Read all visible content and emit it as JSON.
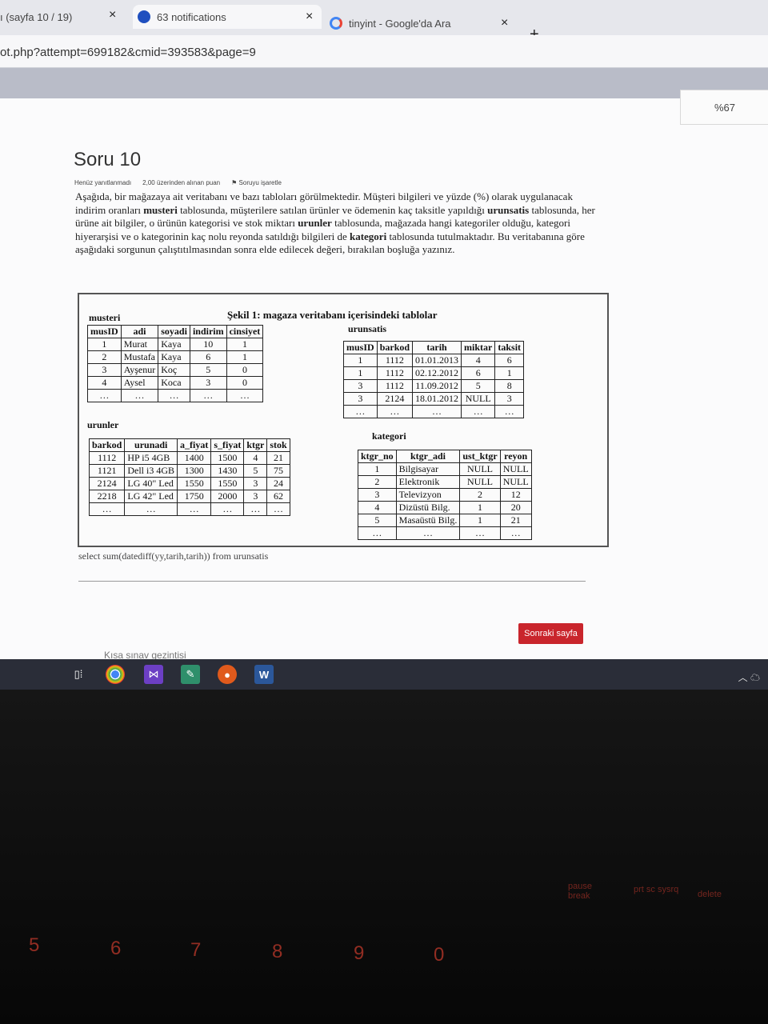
{
  "browser": {
    "tabs": [
      {
        "title": "ı (sayfa 10 / 19)"
      },
      {
        "title": "63 notifications"
      },
      {
        "title": "tinyint - Google'da Ara"
      }
    ],
    "close_glyph": "×",
    "new_tab_glyph": "+",
    "url": "ot.php?attempt=699182&cmid=393583&page=9",
    "zoom": "%67"
  },
  "question": {
    "title": "Soru 10",
    "status": "Henüz yanıtlanmadı",
    "points": "2,00 üzerinden alınan puan",
    "flag": "Soruyu işaretle",
    "text_parts": [
      {
        "t": "Aşağıda, bir mağazaya ait veritabanı ve bazı tabloları görülmektedir. Müşteri bilgileri ve yüzde (%) olarak uygulanacak indirim oranları ",
        "b": false
      },
      {
        "t": "musteri",
        "b": true
      },
      {
        "t": " tablosunda, müşterilere satılan ürünler ve ödemenin kaç taksitle yapıldığı ",
        "b": false
      },
      {
        "t": "urunsatis",
        "b": true
      },
      {
        "t": " tablosunda, her ürüne ait bilgiler, o ürünün kategorisi ve stok miktarı ",
        "b": false
      },
      {
        "t": "urunler",
        "b": true
      },
      {
        "t": " tablosunda, mağazada hangi kategoriler olduğu, kategori hiyerarşisi ve o kategorinin kaç nolu reyonda satıldığı bilgileri de ",
        "b": false
      },
      {
        "t": "kategori",
        "b": true
      },
      {
        "t": " tablosunda tutulmaktadır. Bu veritabanına göre aşağıdaki sorgunun çalıştıtılmasından sonra elde edilecek değeri, bırakılan boşluğa yazınız.",
        "b": false
      }
    ],
    "sql": "select sum(datediff(yy,tarih,tarih)) from urunsatis",
    "next_button": "Sonraki sayfa",
    "quiz_nav": "Kısa sınav gezintisi"
  },
  "figure": {
    "caption": "Şekil 1: magaza veritabanı içerisindeki tablolar",
    "musteri": {
      "label": "musteri",
      "headers": [
        "musID",
        "adi",
        "soyadi",
        "indirim",
        "cinsiyet"
      ],
      "rows": [
        [
          "1",
          "Murat",
          "Kaya",
          "10",
          "1"
        ],
        [
          "2",
          "Mustafa",
          "Kaya",
          "6",
          "1"
        ],
        [
          "3",
          "Ayşenur",
          "Koç",
          "5",
          "0"
        ],
        [
          "4",
          "Aysel",
          "Koca",
          "3",
          "0"
        ],
        [
          "…",
          "…",
          "…",
          "…",
          "…"
        ]
      ]
    },
    "urunsatis": {
      "label": "urunsatis",
      "headers": [
        "musID",
        "barkod",
        "tarih",
        "miktar",
        "taksit"
      ],
      "rows": [
        [
          "1",
          "1112",
          "01.01.2013",
          "4",
          "6"
        ],
        [
          "1",
          "1112",
          "02.12.2012",
          "6",
          "1"
        ],
        [
          "3",
          "1112",
          "11.09.2012",
          "5",
          "8"
        ],
        [
          "3",
          "2124",
          "18.01.2012",
          "NULL",
          "3"
        ],
        [
          "…",
          "…",
          "…",
          "…",
          "…"
        ]
      ]
    },
    "urunler": {
      "label": "urunler",
      "headers": [
        "barkod",
        "urunadi",
        "a_fiyat",
        "s_fiyat",
        "ktgr",
        "stok"
      ],
      "rows": [
        [
          "1112",
          "HP i5 4GB",
          "1400",
          "1500",
          "4",
          "21"
        ],
        [
          "1121",
          "Dell i3 4GB",
          "1300",
          "1430",
          "5",
          "75"
        ],
        [
          "2124",
          "LG 40\" Led",
          "1550",
          "1550",
          "3",
          "24"
        ],
        [
          "2218",
          "LG 42\" Led",
          "1750",
          "2000",
          "3",
          "62"
        ],
        [
          "…",
          "…",
          "…",
          "…",
          "…",
          "…"
        ]
      ]
    },
    "kategori": {
      "label": "kategori",
      "headers": [
        "ktgr_no",
        "ktgr_adi",
        "ust_ktgr",
        "reyon"
      ],
      "rows": [
        [
          "1",
          "Bilgisayar",
          "NULL",
          "NULL"
        ],
        [
          "2",
          "Elektronik",
          "NULL",
          "NULL"
        ],
        [
          "3",
          "Televizyon",
          "2",
          "12"
        ],
        [
          "4",
          "Dizüstü Bilg.",
          "1",
          "20"
        ],
        [
          "5",
          "Masaüstü Bilg.",
          "1",
          "21"
        ],
        [
          "…",
          "…",
          "…",
          "…"
        ]
      ]
    }
  },
  "taskbar": {
    "apps": [
      "task-view",
      "chrome",
      "visual-studio",
      "paint",
      "office-app",
      "word"
    ]
  },
  "keyboard": {
    "number_keys": [
      "5",
      "6",
      "7",
      "8",
      "9",
      "0"
    ],
    "fn_labels": [
      "pause break",
      "prt sc sysrq",
      "delete"
    ]
  }
}
